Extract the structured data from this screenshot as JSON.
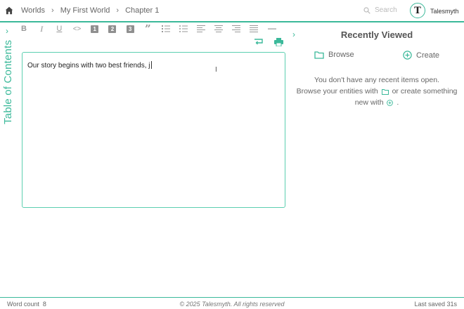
{
  "breadcrumb": {
    "items": [
      "Worlds",
      "My First World",
      "Chapter 1"
    ]
  },
  "search": {
    "placeholder": "Search"
  },
  "brand": {
    "name": "Talesmyth",
    "logo_letter": "T"
  },
  "toc": {
    "label": "Table of Contents"
  },
  "toolbar": {
    "heading1": "1",
    "heading2": "2",
    "heading3": "3",
    "icons": [
      "bold-icon",
      "italic-icon",
      "underline-icon",
      "code-icon",
      "heading-1-icon",
      "heading-2-icon",
      "heading-3-icon",
      "blockquote-icon",
      "ordered-list-icon",
      "bullet-list-icon",
      "align-left-icon",
      "align-center-icon",
      "align-right-icon",
      "align-justify-icon",
      "horizontal-rule-icon",
      "wrap-icon",
      "print-icon"
    ]
  },
  "editor": {
    "text": "Our story begins with two best friends, j"
  },
  "recent": {
    "title": "Recently Viewed",
    "browse_label": "Browse",
    "create_label": "Create",
    "line1": "You don't have any recent items open.",
    "line2a": "Browse your entities with",
    "line2b": "or create something",
    "line3a": "new with",
    "line3b": "."
  },
  "footer": {
    "word_count_label": "Word count",
    "word_count": "8",
    "copyright": "© 2025 Talesmyth. All rights reserved",
    "last_saved": "Last saved 31s"
  },
  "colors": {
    "accent": "#3bb99a"
  }
}
